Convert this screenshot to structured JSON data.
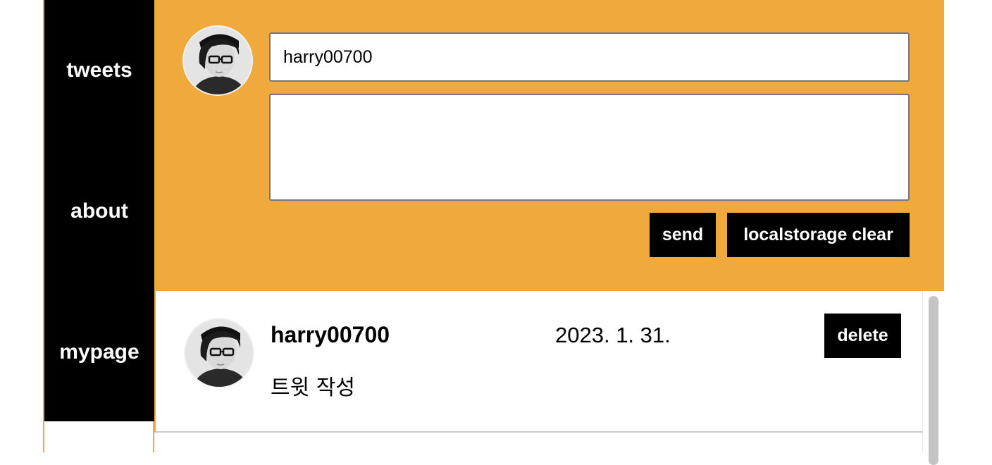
{
  "sidebar": {
    "items": [
      {
        "label": "tweets"
      },
      {
        "label": "about"
      },
      {
        "label": "mypage"
      }
    ]
  },
  "compose": {
    "username_value": "harry00700",
    "body_value": "",
    "send_label": "send",
    "clear_label": "localstorage clear"
  },
  "tweets": [
    {
      "username": "harry00700",
      "date": "2023. 1. 31.",
      "text": "트윗 작성",
      "delete_label": "delete"
    }
  ],
  "colors": {
    "accent": "#f0a93c",
    "sidebar": "#000000",
    "button": "#000000"
  }
}
